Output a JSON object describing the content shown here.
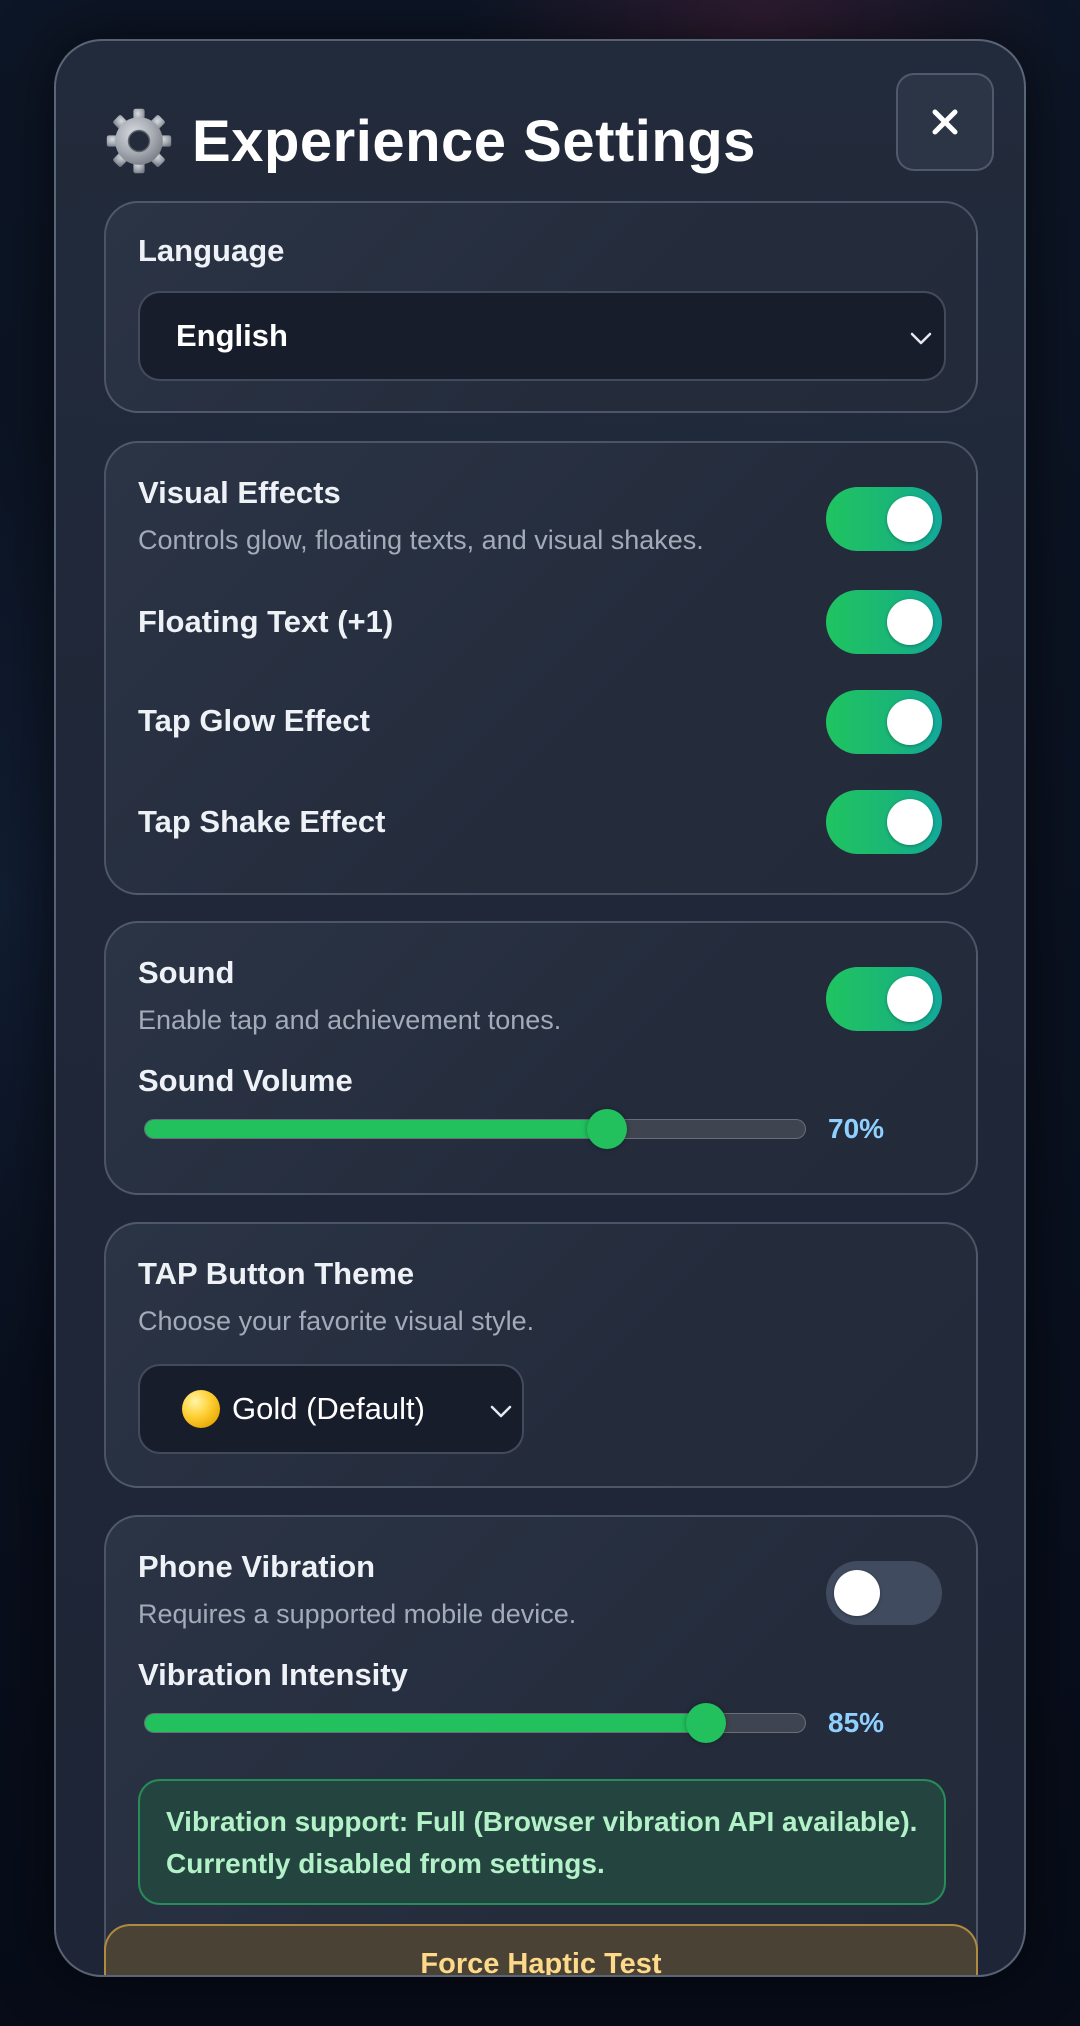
{
  "dialog": {
    "title": "Experience Settings",
    "close_label": "✕"
  },
  "language": {
    "label": "Language",
    "selected": "English"
  },
  "visual": {
    "effects": {
      "label": "Visual Effects",
      "description": "Controls glow, floating texts, and visual shakes.",
      "enabled": true
    },
    "floating_text": {
      "label": "Floating Text (+1)",
      "enabled": true
    },
    "tap_glow": {
      "label": "Tap Glow Effect",
      "enabled": true
    },
    "tap_shake": {
      "label": "Tap Shake Effect",
      "enabled": true
    }
  },
  "sound": {
    "label": "Sound",
    "description": "Enable tap and achievement tones.",
    "enabled": true,
    "volume_label": "Sound Volume",
    "volume_value": 70,
    "volume_text": "70%"
  },
  "theme": {
    "label": "TAP Button Theme",
    "description": "Choose your favorite visual style.",
    "selected": "Gold (Default)",
    "icon": "gold-coin-icon"
  },
  "vibration": {
    "label": "Phone Vibration",
    "description": "Requires a supported mobile device.",
    "enabled": false,
    "intensity_label": "Vibration Intensity",
    "intensity_value": 85,
    "intensity_text": "85%",
    "support_notice": "Vibration support: Full (Browser vibration API available). Currently disabled from settings."
  },
  "haptic_test": {
    "label": "Force Haptic Test"
  },
  "colors": {
    "accent_green": "#22c15e",
    "toggle_teal": "#12a89c",
    "percent_blue": "#8fd0ff",
    "haptic_gold": "#ffd98a"
  }
}
